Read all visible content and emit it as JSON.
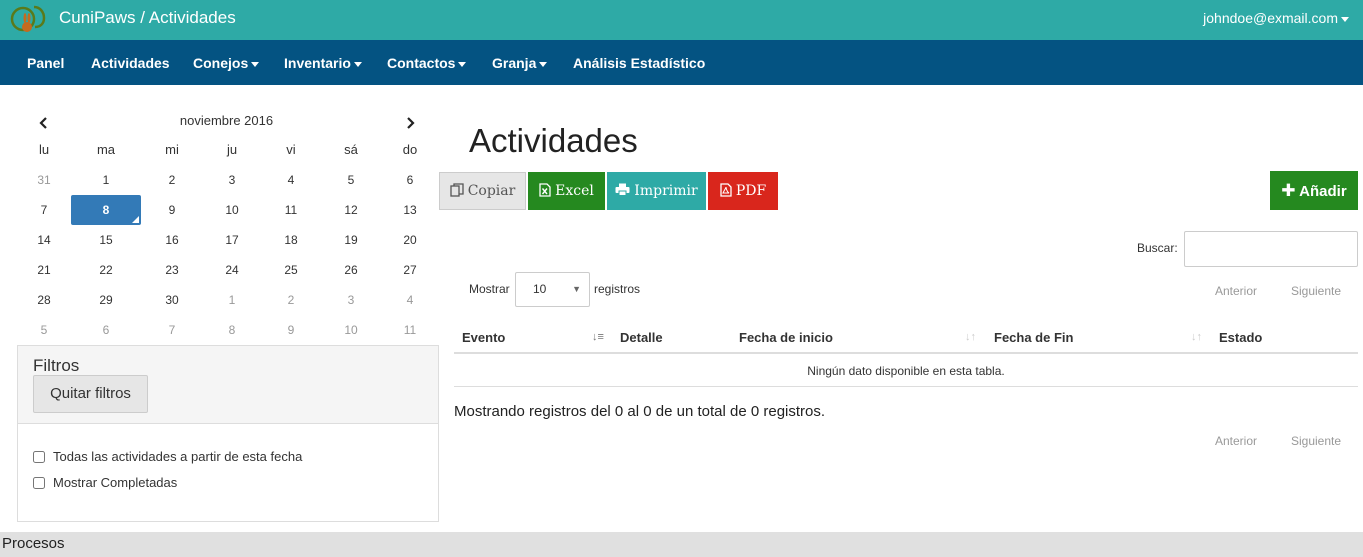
{
  "header": {
    "app_title": "CuniPaws / Actividades",
    "user_email": "johndoe@exmail.com",
    "brand_color": "#2eaaa6",
    "logo_icon": "rabbit-logo-icon"
  },
  "nav": {
    "color": "#045382",
    "items": [
      {
        "label": "Panel"
      },
      {
        "label": "Actividades"
      },
      {
        "label": "Conejos",
        "dropdown": true
      },
      {
        "label": "Inventario",
        "dropdown": true
      },
      {
        "label": "Contactos",
        "dropdown": true
      },
      {
        "label": "Granja",
        "dropdown": true
      },
      {
        "label": "Análisis Estadístico"
      }
    ]
  },
  "calendar": {
    "month_label": "noviembre 2016",
    "prev_icon": "chevron-left-icon",
    "next_icon": "chevron-right-icon",
    "weekdays": [
      "lu",
      "ma",
      "mi",
      "ju",
      "vi",
      "sá",
      "do"
    ],
    "weeks": [
      [
        {
          "d": "31",
          "o": true
        },
        {
          "d": "1"
        },
        {
          "d": "2"
        },
        {
          "d": "3"
        },
        {
          "d": "4"
        },
        {
          "d": "5"
        },
        {
          "d": "6"
        }
      ],
      [
        {
          "d": "7"
        },
        {
          "d": "8",
          "selected": true
        },
        {
          "d": "9"
        },
        {
          "d": "10"
        },
        {
          "d": "11"
        },
        {
          "d": "12"
        },
        {
          "d": "13"
        }
      ],
      [
        {
          "d": "14"
        },
        {
          "d": "15"
        },
        {
          "d": "16"
        },
        {
          "d": "17"
        },
        {
          "d": "18"
        },
        {
          "d": "19"
        },
        {
          "d": "20"
        }
      ],
      [
        {
          "d": "21"
        },
        {
          "d": "22"
        },
        {
          "d": "23"
        },
        {
          "d": "24"
        },
        {
          "d": "25"
        },
        {
          "d": "26"
        },
        {
          "d": "27"
        }
      ],
      [
        {
          "d": "28"
        },
        {
          "d": "29"
        },
        {
          "d": "30"
        },
        {
          "d": "1",
          "o": true
        },
        {
          "d": "2",
          "o": true
        },
        {
          "d": "3",
          "o": true
        },
        {
          "d": "4",
          "o": true
        }
      ],
      [
        {
          "d": "5",
          "o": true
        },
        {
          "d": "6",
          "o": true
        },
        {
          "d": "7",
          "o": true
        },
        {
          "d": "8",
          "o": true
        },
        {
          "d": "9",
          "o": true
        },
        {
          "d": "10",
          "o": true
        },
        {
          "d": "11",
          "o": true
        }
      ]
    ],
    "selected_color": "#337ab7"
  },
  "filters": {
    "title": "Filtros",
    "clear_label": "Quitar filtros",
    "checkboxes": [
      {
        "label": "Todas las actividades a partir de esta fecha",
        "checked": false
      },
      {
        "label": "Mostrar Completadas",
        "checked": false
      }
    ]
  },
  "main": {
    "title": "Actividades",
    "toolbar": {
      "copy_label": "Copiar",
      "excel_label": "Excel",
      "print_label": "Imprimir",
      "pdf_label": "PDF",
      "add_label": "Añadir",
      "copy_icon": "copy-icon",
      "excel_icon": "excel-file-icon",
      "print_icon": "printer-icon",
      "pdf_icon": "pdf-file-icon",
      "add_icon": "plus-icon"
    },
    "search_label": "Buscar:",
    "search_value": "",
    "length": {
      "before": "Mostrar",
      "value": "10",
      "after": "registros"
    },
    "pager": {
      "prev": "Anterior",
      "next": "Siguiente"
    },
    "columns": [
      "Evento",
      "Detalle",
      "Fecha de inicio",
      "Fecha de Fin",
      "Estado"
    ],
    "empty_text": "Ningún dato disponible en esta tabla.",
    "info": "Mostrando registros del 0 al 0 de un total de 0 registros."
  },
  "footer": {
    "title": "Procesos"
  }
}
